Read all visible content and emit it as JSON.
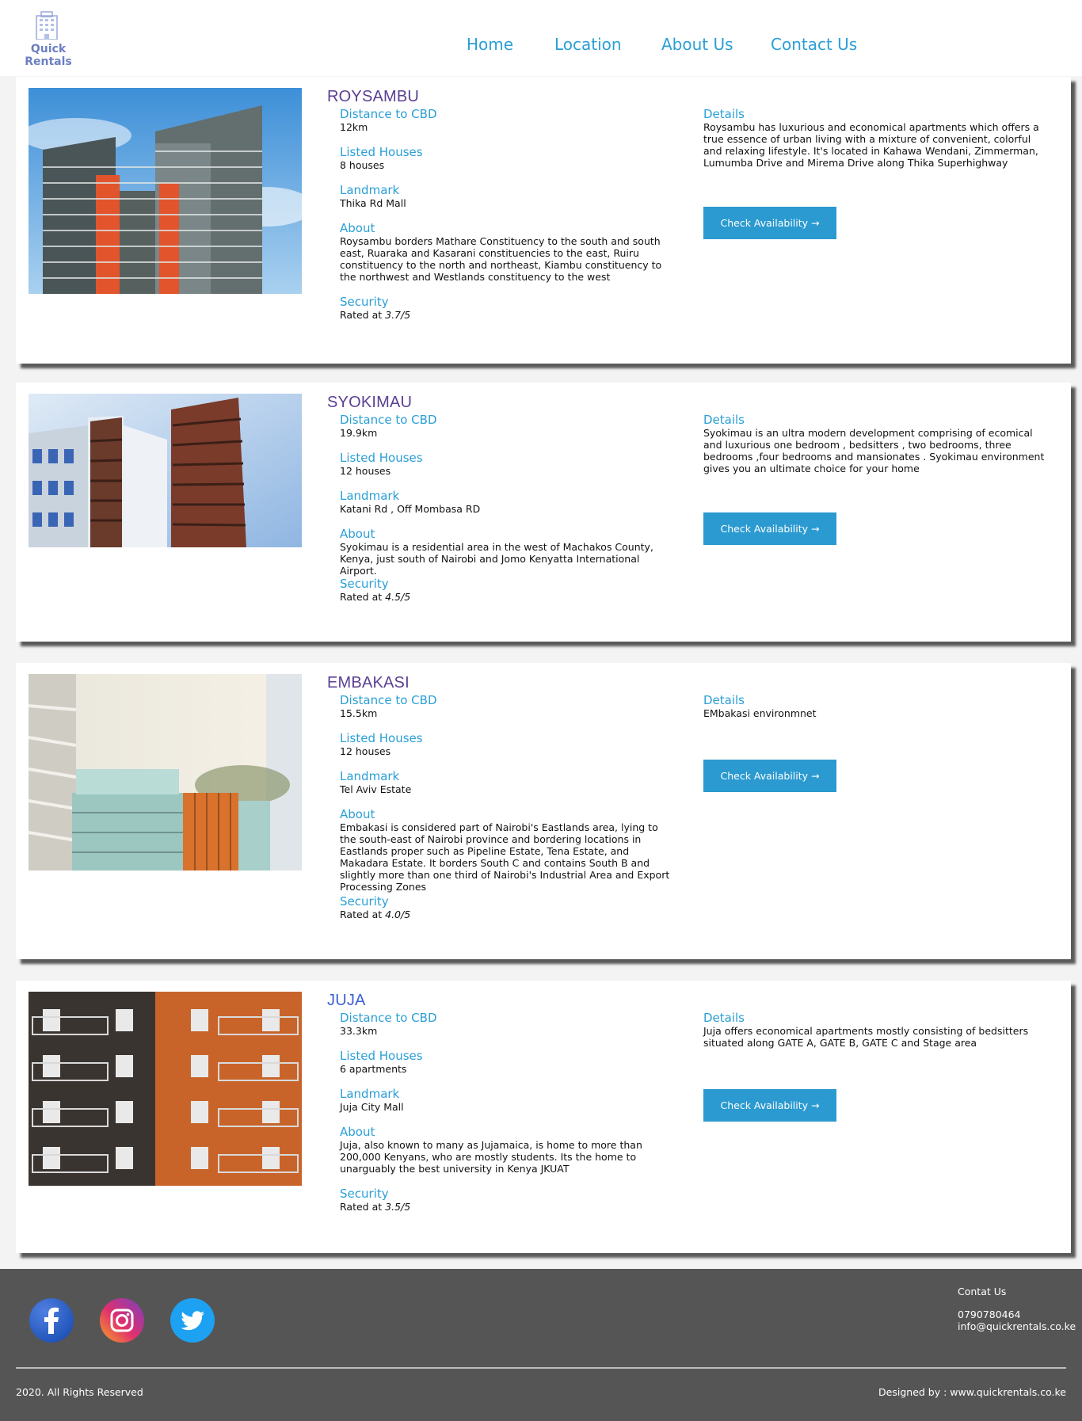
{
  "header": {
    "logo_text": "Quick Rentals",
    "nav": [
      "Home",
      "Location",
      "About Us",
      "Contact Us"
    ]
  },
  "labels": {
    "distance": "Distance to CBD",
    "houses": "Listed Houses",
    "landmark": "Landmark",
    "about": "About",
    "security": "Security",
    "details": "Details",
    "rated_prefix": "Rated at",
    "button": "Check Availability →"
  },
  "listings": [
    {
      "name": "ROYSAMBU",
      "distance": "12km",
      "houses": "8 houses",
      "landmark": "Thika Rd Mall",
      "about": "Roysambu borders Mathare Constituency to the south and south east, Ruaraka and Kasarani constituencies to the east, Ruiru constituency to the north and northeast, Kiambu constituency to the northwest and Westlands constituency to the west",
      "rating": "3.7/5",
      "details": "Roysambu has luxurious and economical apartments which offers a true essence of urban living with a mixture of convenient, colorful and relaxing lifestyle. It's located in Kahawa Wendani, Zimmerman, Lumumba Drive and Mirema Drive along Thika Superhighway"
    },
    {
      "name": "SYOKIMAU",
      "distance": "19.9km",
      "houses": "12 houses",
      "landmark": "Katani Rd , Off Mombasa RD",
      "about": "Syokimau is a residential area in the west of Machakos County, Kenya, just south of Nairobi and Jomo Kenyatta International Airport.",
      "rating": "4.5/5",
      "details": "Syokimau is an ultra modern development comprising of ecomical and luxurious one bedroom , bedsitters , two bedrooms, three bedrooms ,four bedrooms and mansionates . Syokimau environment gives you an ultimate choice for your home"
    },
    {
      "name": "EMBAKASI",
      "distance": "15.5km",
      "houses": "12 houses",
      "landmark": "Tel Aviv Estate",
      "about": "Embakasi is considered part of Nairobi's Eastlands area, lying to the south-east of Nairobi province and bordering locations in Eastlands proper such as Pipeline Estate, Tena Estate, and Makadara Estate. It borders South C and contains South B and slightly more than one third of Nairobi's Industrial Area and Export Processing Zones",
      "rating": "4.0/5",
      "details": "EMbakasi environmnet"
    },
    {
      "name": "JUJA",
      "distance": "33.3km",
      "houses": "6 apartments",
      "landmark": "Juja City Mall",
      "about": "Juja, also known to many as Jujamaica, is home to more than 200,000 Kenyans, who are mostly students. Its the home to unarguably the best university in Kenya JKUAT",
      "rating": "3.5/5",
      "details": "Juja offers economical apartments mostly consisting of bedsitters situated along GATE A, GATE B, GATE C and Stage area"
    }
  ],
  "footer": {
    "contact_heading": "Contat Us",
    "phone": "0790780464",
    "email": "info@quickrentals.co.ke",
    "copyright": "2020. All Rights Reserved",
    "designed_by": "Designed by : www.quickrentals.co.ke",
    "social": [
      "facebook-icon",
      "instagram-icon",
      "twitter-icon"
    ]
  },
  "colors": {
    "accent": "#2a9fd6",
    "title": "#5b3f94",
    "button": "#2b9ad0",
    "footer_bg": "#555555"
  }
}
